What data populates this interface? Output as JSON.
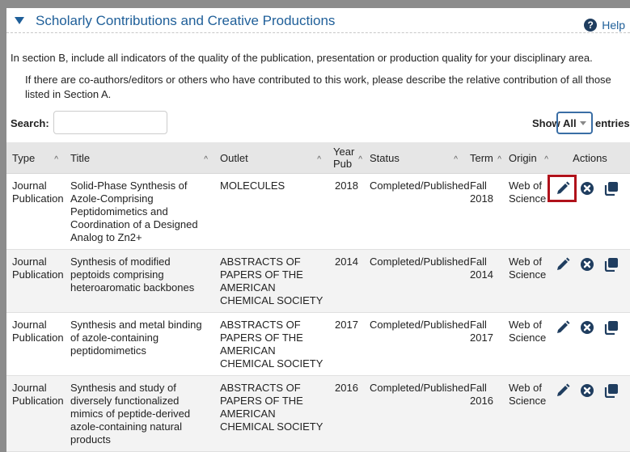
{
  "section": {
    "title": "Scholarly Contributions and Creative Productions",
    "help_label": "Help",
    "help_icon": "question-circle-icon"
  },
  "intro_text": "In section B, include all indicators of the quality of the publication, presentation or production quality for your disciplinary area.",
  "note_text": "If there are co-authors/editors or others who have contributed to this work, please describe the relative contribution of all those listed in Section A.",
  "search": {
    "label": "Search:",
    "value": ""
  },
  "length": {
    "show_label": "Show",
    "selected": "All",
    "entries_label": "entries"
  },
  "columns": {
    "type": "Type",
    "title": "Title",
    "outlet": "Outlet",
    "year": "Year Pub",
    "status": "Status",
    "term": "Term",
    "origin": "Origin",
    "actions": "Actions"
  },
  "rows": [
    {
      "type": "Journal Publication",
      "title": "Solid-Phase Synthesis of Azole-Comprising Peptidomimetics and Coordination of a Designed Analog to Zn2+",
      "outlet": "MOLECULES",
      "year": "2018",
      "status": "Completed/Published",
      "term": "Fall 2018",
      "origin": "Web of Science"
    },
    {
      "type": "Journal Publication",
      "title": "Synthesis of modified peptoids comprising heteroaromatic backbones",
      "outlet": "ABSTRACTS OF PAPERS OF THE AMERICAN CHEMICAL SOCIETY",
      "year": "2014",
      "status": "Completed/Published",
      "term": "Fall 2014",
      "origin": "Web of Science"
    },
    {
      "type": "Journal Publication",
      "title": "Synthesis and metal binding of azole-containing peptidomimetics",
      "outlet": "ABSTRACTS OF PAPERS OF THE AMERICAN CHEMICAL SOCIETY",
      "year": "2017",
      "status": "Completed/Published",
      "term": "Fall 2017",
      "origin": "Web of Science"
    },
    {
      "type": "Journal Publication",
      "title": "Synthesis and study of diversely functionalized mimics of peptide-derived azole-containing natural products",
      "outlet": "ABSTRACTS OF PAPERS OF THE AMERICAN CHEMICAL SOCIETY",
      "year": "2016",
      "status": "Completed/Published",
      "term": "Fall 2016",
      "origin": "Web of Science"
    }
  ],
  "icons": {
    "edit": "pencil-icon",
    "delete": "remove-circle-icon",
    "copy": "copy-icon"
  },
  "colors": {
    "accent": "#1f5f99",
    "highlight": "#b0121b",
    "icon": "#1f3d5f"
  }
}
